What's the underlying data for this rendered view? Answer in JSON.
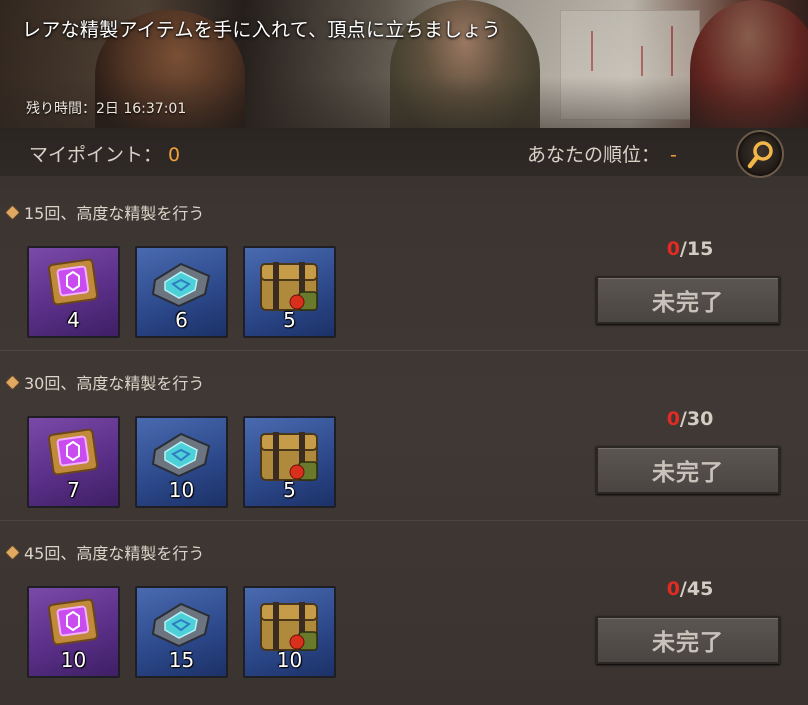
{
  "banner": {
    "title": "レアな精製アイテムを手に入れて、頂点に立ちましょう",
    "timer": "残り時間：2日 16:37:01"
  },
  "points": {
    "my_label": "マイポイント：",
    "my_value": "0",
    "rank_label": "あなたの順位：",
    "rank_value": "-"
  },
  "rewards": [
    {
      "title": "15回、高度な精製を行う",
      "items": [
        {
          "icon": "purple-chip-icon",
          "count": "4"
        },
        {
          "icon": "blue-chip-icon",
          "count": "6"
        },
        {
          "icon": "supply-bag-icon",
          "count": "5"
        }
      ],
      "progress_current": "0",
      "progress_total": "/15",
      "status": "未完了"
    },
    {
      "title": "30回、高度な精製を行う",
      "items": [
        {
          "icon": "purple-chip-icon",
          "count": "7"
        },
        {
          "icon": "blue-chip-icon",
          "count": "10"
        },
        {
          "icon": "supply-bag-icon",
          "count": "5"
        }
      ],
      "progress_current": "0",
      "progress_total": "/30",
      "status": "未完了"
    },
    {
      "title": "45回、高度な精製を行う",
      "items": [
        {
          "icon": "purple-chip-icon",
          "count": "10"
        },
        {
          "icon": "blue-chip-icon",
          "count": "15"
        },
        {
          "icon": "supply-bag-icon",
          "count": "10"
        }
      ],
      "progress_current": "0",
      "progress_total": "/45",
      "status": "未完了"
    }
  ],
  "colors": {
    "accent_orange": "#f0a13a",
    "progress_red": "#e22b22",
    "purple_tile": "#5a2f88",
    "blue_tile": "#2d4a8c"
  }
}
